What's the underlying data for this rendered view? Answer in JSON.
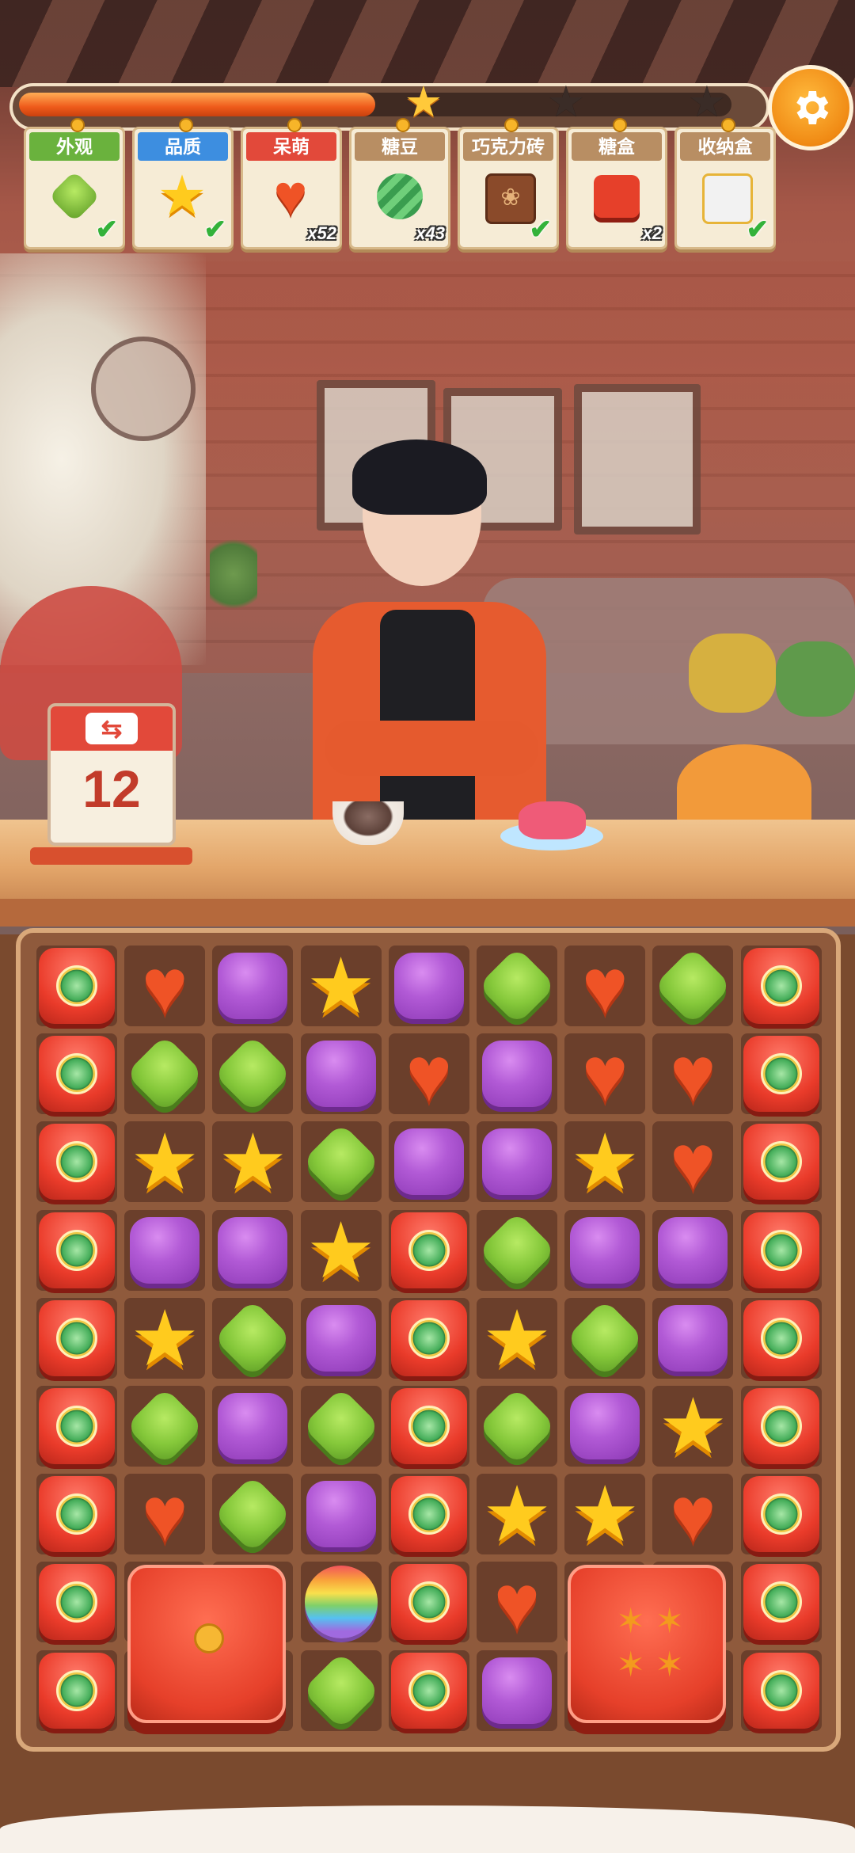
{
  "progress": {
    "fraction": 0.5,
    "stars_earned": 1,
    "stars_total": 3
  },
  "settings": {
    "icon": "gear-icon"
  },
  "orders": [
    {
      "label": "外观",
      "color": "#6ab23d",
      "item": "green-candy",
      "count": "",
      "done": true
    },
    {
      "label": "品质",
      "color": "#3d8ee0",
      "item": "yellow-star-candy",
      "count": "",
      "done": true
    },
    {
      "label": "呆萌",
      "color": "#e2493a",
      "item": "red-heart-candy",
      "count": "x52",
      "done": false
    },
    {
      "label": "糖豆",
      "color": "#b88e63",
      "item": "green-bean-candy",
      "count": "x43",
      "done": false
    },
    {
      "label": "巧克力砖",
      "color": "#b88e63",
      "item": "chocolate-paw-brick",
      "count": "",
      "done": true
    },
    {
      "label": "糖盒",
      "color": "#b88e63",
      "item": "candy-box",
      "count": "x2",
      "done": false
    },
    {
      "label": "收纳盒",
      "color": "#b88e63",
      "item": "storage-box",
      "count": "",
      "done": true
    }
  ],
  "moves": {
    "value": "12",
    "icon": "swap-icon"
  },
  "board": {
    "rows": [
      [
        "blocker",
        "heart",
        "purple",
        "star",
        "purple",
        "green",
        "heart",
        "green",
        "blocker"
      ],
      [
        "blocker",
        "green",
        "green",
        "purple",
        "heart",
        "purple",
        "heart",
        "heart",
        "blocker"
      ],
      [
        "blocker",
        "star",
        "star",
        "green",
        "purple",
        "purple",
        "star",
        "heart",
        "blocker"
      ],
      [
        "blocker",
        "purple",
        "purple",
        "star",
        "blocker",
        "green",
        "purple",
        "purple",
        "blocker"
      ],
      [
        "blocker",
        "star",
        "green",
        "purple",
        "blocker",
        "star",
        "green",
        "purple",
        "blocker"
      ],
      [
        "blocker",
        "green",
        "purple",
        "green",
        "blocker",
        "green",
        "purple",
        "star",
        "blocker"
      ],
      [
        "blocker",
        "heart",
        "green",
        "purple",
        "blocker",
        "star",
        "star",
        "heart",
        "blocker"
      ],
      [
        "blocker",
        "box",
        "box",
        "rainbow",
        "blocker",
        "heart",
        "box2",
        "box2",
        "blocker"
      ],
      [
        "blocker",
        "box",
        "box",
        "green",
        "blocker",
        "purple",
        "box2",
        "box2",
        "blocker"
      ]
    ]
  }
}
